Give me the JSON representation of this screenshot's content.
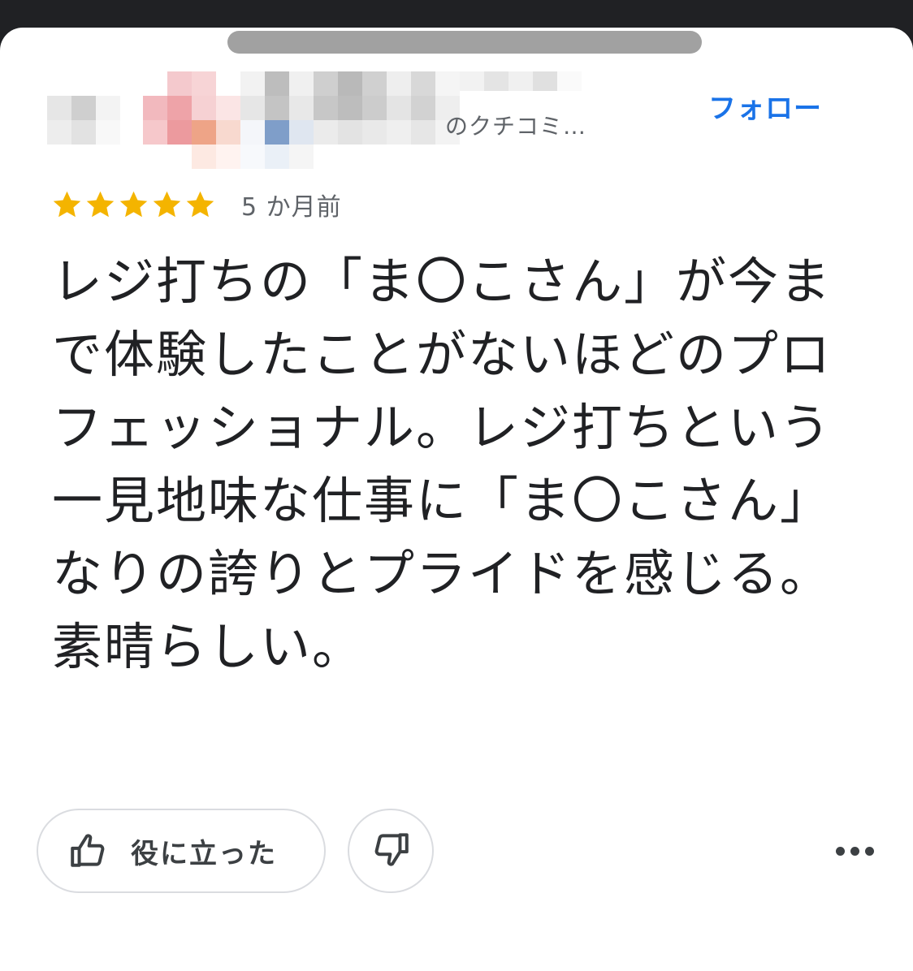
{
  "reviewer": {
    "subtitle": "のクチコミ…",
    "follow_label": "フォロー"
  },
  "review": {
    "rating": 5,
    "rating_max": 5,
    "date": "5 か月前",
    "text": "レジ打ちの「ま〇こさん」が今まで体験したことがないほどのプロフェッショナル。レジ打ちという一見地味な仕事に「ま〇こさん」なりの誇りとプライドを感じる。素晴らしい。"
  },
  "actions": {
    "helpful_label": "役に立った",
    "helpful_icon": "thumbs-up-icon",
    "dislike_icon": "thumbs-down-icon",
    "more_icon": "more-options-icon"
  },
  "colors": {
    "star": "#f4b400",
    "accent": "#1a73e8",
    "text": "#202124",
    "muted": "#5f6368"
  }
}
